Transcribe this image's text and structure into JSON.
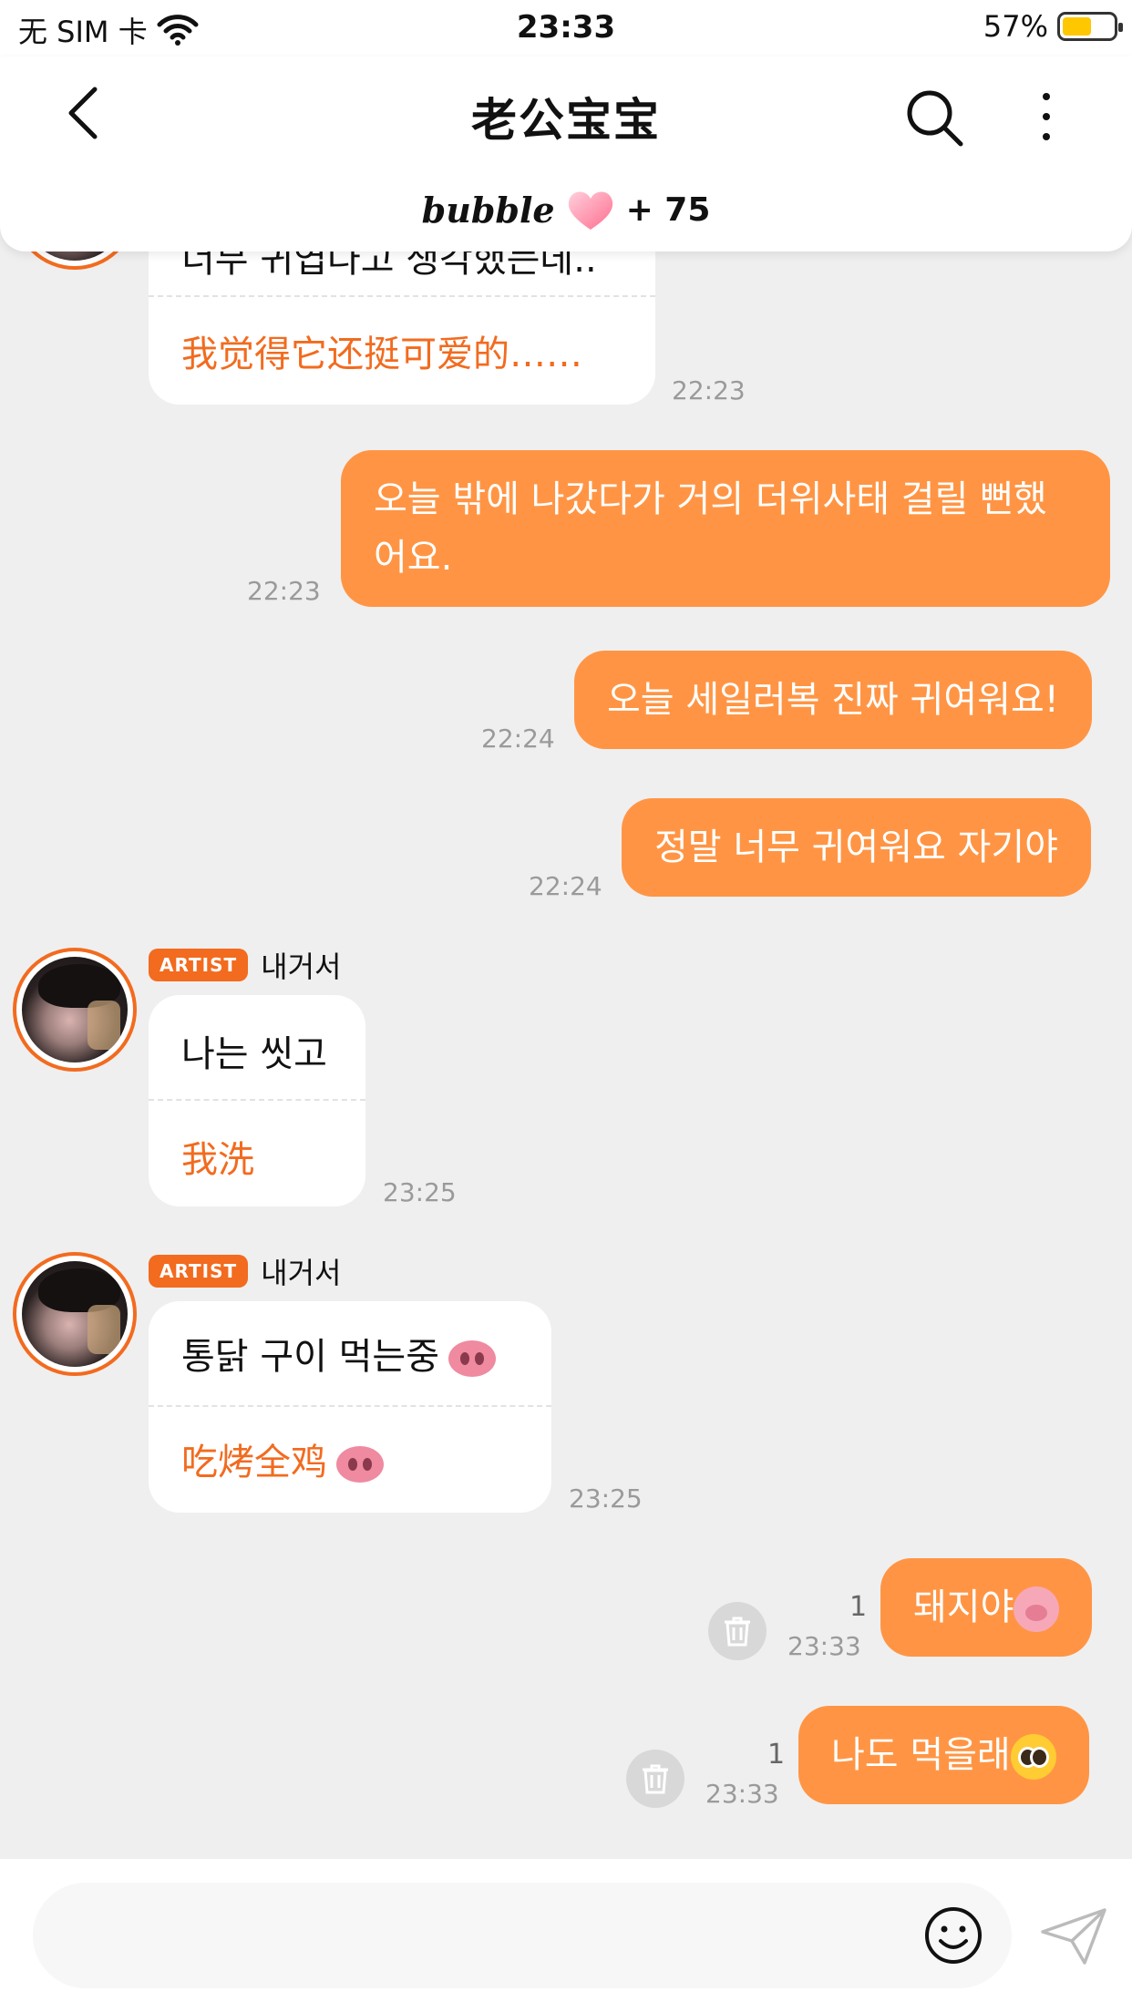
{
  "status_bar": {
    "carrier": "无 SIM 卡",
    "time": "23:33",
    "battery": "57%",
    "battery_level": 0.57
  },
  "header": {
    "title": "老公宝宝",
    "bubble_logo": "bubble",
    "bubble_count": "+ 75"
  },
  "messages": {
    "m1": {
      "partial_text": "너무 귀엽다고 생각했는데..",
      "translation": "我觉得它还挺可爱的……",
      "time": "22:23"
    },
    "m2": {
      "text": "오늘 밖에 나갔다가 거의 더위사태 걸릴 뻔했어요.",
      "time": "22:23"
    },
    "m3": {
      "text": "오늘 세일러복 진짜 귀여워요!",
      "time": "22:24"
    },
    "m4": {
      "text": "정말 너무 귀여워요 자기야",
      "time": "22:24"
    },
    "m5": {
      "badge": "ARTIST",
      "sender": "내거서",
      "text": "나는 씻고",
      "translation": "我洗",
      "time": "23:25"
    },
    "m6": {
      "badge": "ARTIST",
      "sender": "내거서",
      "text": "통닭 구이 먹는중",
      "translation": "吃烤全鸡",
      "emoji": "pig-nose",
      "time": "23:25"
    },
    "m7": {
      "text": "돼지야",
      "emoji": "pig-face",
      "read_count": "1",
      "time": "23:33"
    },
    "m8": {
      "text": "나도 먹을래",
      "emoji": "pleading-face",
      "read_count": "1",
      "time": "23:33"
    }
  },
  "input": {
    "placeholder": "",
    "value": ""
  },
  "colors": {
    "accent": "#f26b1f",
    "bubble_out": "#ff9544",
    "background": "#efefef"
  }
}
